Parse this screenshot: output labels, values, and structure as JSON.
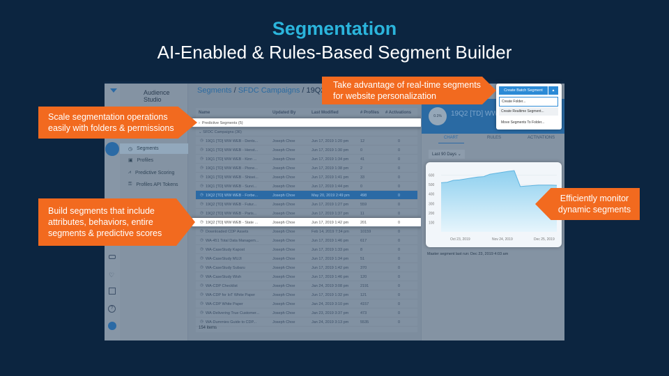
{
  "slide": {
    "title": "Segmentation",
    "subtitle": "AI-Enabled & Rules-Based Segment Builder"
  },
  "app": {
    "brand": "Audience Studio",
    "nav": [
      {
        "label": "Segments",
        "icon": "clock-icon",
        "selected": true
      },
      {
        "label": "Profiles",
        "icon": "profile-card-icon"
      },
      {
        "label": "Predictive Scoring",
        "icon": "chart-icon"
      },
      {
        "label": "Profiles API Tokens",
        "icon": "key-icon"
      }
    ],
    "breadcrumb": {
      "a": "Segments",
      "b": "SFDC Campaigns",
      "c": "19Q2"
    },
    "table": {
      "headers": [
        "Name",
        "Updated By",
        "Last Modified",
        "# Profiles",
        "# Activations"
      ],
      "folder_collapsed": "Predictive Segments (5)",
      "folder_open": "SFDC Campaigns (36)",
      "rows": [
        [
          "19Q1 [TD] WW WEB - Dents...",
          "Joseph Choe",
          "Jun 17, 2019 1:20 pm",
          "12",
          "0"
        ],
        [
          "19Q1 [TD] WW WEB - Henst...",
          "Joseph Choe",
          "Jun 17, 2019 1:30 pm",
          "0",
          "0"
        ],
        [
          "19Q1 [TD] WW WEB - Kinn ...",
          "Joseph Choe",
          "Jun 17, 2019 1:34 pm",
          "41",
          "0"
        ],
        [
          "19Q1 [TD] WW WEB - Pione...",
          "Joseph Choe",
          "Jun 17, 2019 1:38 pm",
          "2",
          "0"
        ],
        [
          "19Q1 [TD] WW WEB - Shisei...",
          "Joseph Choe",
          "Jun 17, 2019 1:41 pm",
          "33",
          "0"
        ],
        [
          "19Q1 [TD] WW WEB - Survi...",
          "Joseph Choe",
          "Jun 17, 2019 1:44 pm",
          "0",
          "0"
        ],
        [
          "19Q2 [TD] WW WEB - Forbe...",
          "Joseph Choe",
          "May 20, 2019 2:49 pm",
          "498",
          "0"
        ],
        [
          "19Q2 [TD] WW WEB - Futur...",
          "Joseph Choe",
          "Jun 17, 2019 1:27 pm",
          "559",
          "0"
        ],
        [
          "19Q2 [TD] WW WEB - Paris...",
          "Joseph Choe",
          "Jun 17, 2019 1:37 pm",
          "11",
          "0"
        ],
        [
          "19Q2 [TD] WW WEB - State ...",
          "Joseph Choe",
          "Jun 17, 2019 1:42 pm",
          "201",
          "0"
        ],
        [
          "Downloaded CDP Assets",
          "Joseph Choe",
          "Feb 14, 2019 7:34 pm",
          "10159",
          "0"
        ],
        [
          "WA-451 Total Data Managem...",
          "Joseph Choe",
          "Jun 17, 2019 1:46 pm",
          "617",
          "0"
        ],
        [
          "WA-CaseStudy Kapost",
          "Joseph Choe",
          "Jun 17, 2019 1:33 pm",
          "8",
          "0"
        ],
        [
          "WA-CaseStudy MUJI",
          "Joseph Choe",
          "Jun 17, 2019 1:34 pm",
          "51",
          "0"
        ],
        [
          "WA-CaseStudy Subaru",
          "Joseph Choe",
          "Jun 17, 2019 1:42 pm",
          "370",
          "0"
        ],
        [
          "WA-CaseStudy Wish",
          "Joseph Choe",
          "Jun 17, 2019 1:46 pm",
          "120",
          "0"
        ],
        [
          "WA-CDP Checklist",
          "Joseph Choe",
          "Jan 24, 2019 3:08 pm",
          "2191",
          "0"
        ],
        [
          "WA-CDP for IoT White Paper",
          "Joseph Choe",
          "Jun 17, 2019 1:32 pm",
          "121",
          "0"
        ],
        [
          "WA-CDP White Paper",
          "Joseph Choe",
          "Jan 24, 2019 3:10 pm",
          "4157",
          "0"
        ],
        [
          "WA-Delivering True Customer...",
          "Joseph Choe",
          "Jan 23, 2019 3:37 pm",
          "473",
          "0"
        ],
        [
          "WA-Dummies Guide to CDP...",
          "Joseph Choe",
          "Jan 24, 2019 3:13 pm",
          "5535",
          "0"
        ]
      ],
      "selected_row": 6,
      "spotlight_row": 9,
      "footer": "154 items"
    },
    "detail": {
      "badge": "0.1%",
      "title": "19Q2 [TD] WW",
      "tabs": [
        "CHART",
        "RULES",
        "ACTIVATIONS"
      ],
      "range": "Last 90 Days",
      "chart": {
        "type": "area",
        "yticks": [
          100,
          200,
          300,
          400,
          500,
          600
        ],
        "ylim": [
          0,
          700
        ],
        "xticks": [
          "Oct 23, 2019",
          "Nov 24, 2019",
          "Dec 25, 2019"
        ],
        "values": [
          520,
          525,
          545,
          550,
          560,
          570,
          580,
          585,
          610,
          620,
          630,
          640,
          648,
          480,
          485,
          490,
          495,
          495,
          495,
          492
        ]
      },
      "last_run": "Master segment last run: Dec 23, 2019 4:03 am"
    },
    "menu": {
      "primary": "Create Batch Segment",
      "items": [
        "Create Folder...",
        "Create Realtime Segment...",
        "Move Segments To Folder..."
      ]
    }
  },
  "callouts": [
    "Scale segmentation operations easily with folders & permissions",
    "Build segments that include attributes, behaviors, entire segments & predictive scores",
    "Take advantage of real-time segments for website personalization",
    "Efficiently monitor dynamic segments"
  ],
  "colors": {
    "accent": "#2bb5dc",
    "callout": "#f26a1f",
    "background": "#0c2540",
    "selected": "#2b6aa5"
  }
}
